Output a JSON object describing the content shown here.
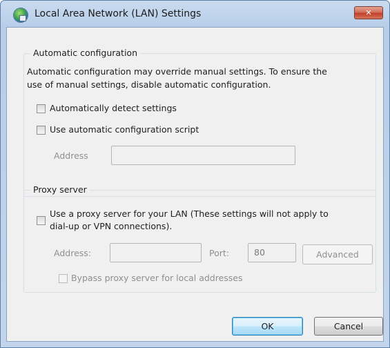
{
  "window": {
    "title": "Local Area Network (LAN) Settings",
    "close_symbol": "✕",
    "icon": "network-globe-icon"
  },
  "auto_config": {
    "group_title": "Automatic configuration",
    "description_line1": "Automatic configuration may override manual settings.  To ensure the",
    "description_line2": "use of manual settings, disable automatic configuration.",
    "detect_settings_label": "Automatically detect settings",
    "detect_settings_checked": false,
    "use_script_label": "Use automatic configuration script",
    "use_script_checked": false,
    "address_label": "Address",
    "address_value": ""
  },
  "proxy": {
    "group_title": "Proxy server",
    "use_proxy_line1": "Use a proxy server for your LAN (These settings will not apply to",
    "use_proxy_line2": "dial-up or VPN connections).",
    "use_proxy_checked": false,
    "address_label": "Address:",
    "address_value": "",
    "port_label": "Port:",
    "port_value": "80",
    "advanced_label": "Advanced",
    "bypass_label": "Bypass proxy server for local addresses",
    "bypass_checked": false
  },
  "buttons": {
    "ok_label": "OK",
    "cancel_label": "Cancel"
  }
}
